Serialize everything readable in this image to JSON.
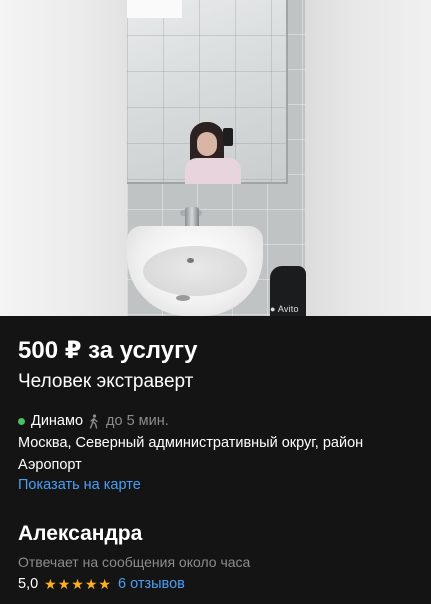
{
  "photo": {
    "watermark": "Avito"
  },
  "listing": {
    "price": "500 ₽ за услугу",
    "title": "Человек экстраверт"
  },
  "location": {
    "metro_station": "Динамо",
    "metro_color": "#47c15f",
    "walk_icon": "walking-person-icon",
    "walk_time": "до 5 мин.",
    "address": "Москва, Северный административный округ, район Аэропорт",
    "map_link": "Показать на карте"
  },
  "seller": {
    "name": "Александра",
    "reply_time": "Отвечает на сообщения около часа",
    "rating": "5,0",
    "stars": 5,
    "star_color": "#ffb021",
    "reviews_link": "6 отзывов"
  },
  "colors": {
    "background": "#141414",
    "link": "#4a9ff5",
    "secondary_text": "#8c8c8c"
  }
}
